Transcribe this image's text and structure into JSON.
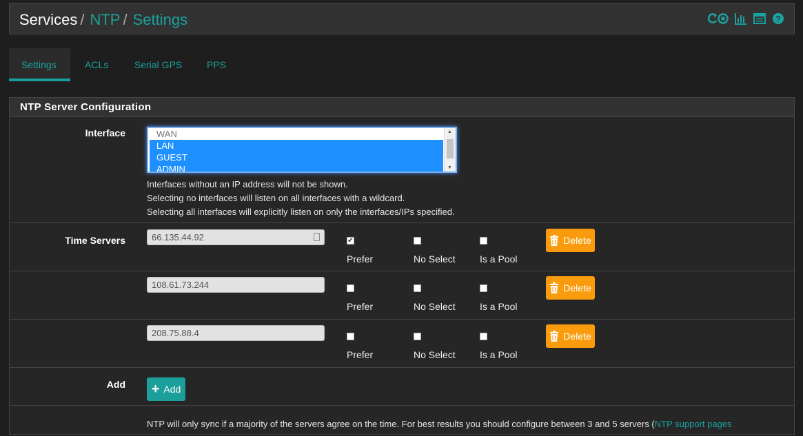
{
  "breadcrumb": {
    "root": "Services",
    "section": "NTP",
    "page": "Settings",
    "separator": "/"
  },
  "header_icons": [
    "reload-icon",
    "bar-chart-icon",
    "list-icon",
    "help-icon"
  ],
  "tabs": [
    {
      "label": "Settings",
      "active": true
    },
    {
      "label": "ACLs",
      "active": false
    },
    {
      "label": "Serial GPS",
      "active": false
    },
    {
      "label": "PPS",
      "active": false
    }
  ],
  "panel": {
    "title": "NTP Server Configuration",
    "interface": {
      "label": "Interface",
      "options": [
        {
          "label": "WAN",
          "selected": false
        },
        {
          "label": "LAN",
          "selected": true
        },
        {
          "label": "GUEST",
          "selected": true
        },
        {
          "label": "ADMIN",
          "selected": true
        }
      ],
      "help": [
        "Interfaces without an IP address will not be shown.",
        "Selecting no interfaces will listen on all interfaces with a wildcard.",
        "Selecting all interfaces will explicitly listen on only the interfaces/IPs specified."
      ]
    },
    "time_servers": {
      "label": "Time Servers",
      "prefer_label": "Prefer",
      "noselect_label": "No Select",
      "pool_label": "Is a Pool",
      "delete_label": "Delete",
      "servers": [
        {
          "address": "66.135.44.92",
          "prefer": true,
          "noselect": false,
          "pool": false
        },
        {
          "address": "108.61.73.244",
          "prefer": false,
          "noselect": false,
          "pool": false
        },
        {
          "address": "208.75.88.4",
          "prefer": false,
          "noselect": false,
          "pool": false
        }
      ]
    },
    "add": {
      "label": "Add",
      "button_label": "Add"
    },
    "footer": {
      "text": "NTP will only sync if a majority of the servers agree on the time. For best results you should configure between 3 and 5 servers (",
      "link": "NTP support pages"
    }
  },
  "colors": {
    "accent": "#1b9f9a",
    "warning": "#f99b0c",
    "select_highlight": "#1e90ff"
  }
}
